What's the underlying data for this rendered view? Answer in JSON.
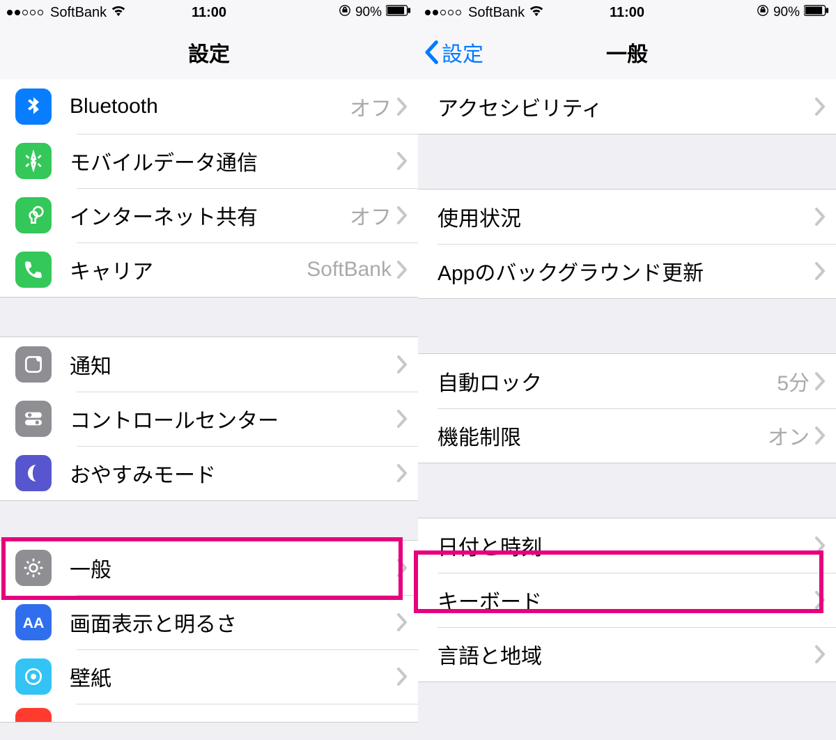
{
  "status": {
    "carrier": "SoftBank",
    "time": "11:00",
    "battery": "90%"
  },
  "left": {
    "title": "設定",
    "sections": [
      {
        "rows": [
          {
            "icon": "bluetooth",
            "color": "ic-blue",
            "label": "Bluetooth",
            "value": "オフ"
          },
          {
            "icon": "cellular",
            "color": "ic-green",
            "label": "モバイルデータ通信",
            "value": ""
          },
          {
            "icon": "hotspot",
            "color": "ic-green",
            "label": "インターネット共有",
            "value": "オフ"
          },
          {
            "icon": "phone",
            "color": "ic-green",
            "label": "キャリア",
            "value": "SoftBank"
          }
        ]
      },
      {
        "rows": [
          {
            "icon": "notify",
            "color": "ic-gray",
            "label": "通知",
            "value": ""
          },
          {
            "icon": "control",
            "color": "ic-gray2",
            "label": "コントロールセンター",
            "value": ""
          },
          {
            "icon": "dnd",
            "color": "ic-purple",
            "label": "おやすみモード",
            "value": ""
          }
        ]
      },
      {
        "rows": [
          {
            "icon": "general",
            "color": "ic-gray",
            "label": "一般",
            "value": ""
          },
          {
            "icon": "display",
            "color": "ic-indigo",
            "label": "画面表示と明るさ",
            "value": ""
          },
          {
            "icon": "wallpaper",
            "color": "ic-teal",
            "label": "壁紙",
            "value": ""
          },
          {
            "icon": "sound",
            "color": "ic-red",
            "label": "",
            "value": ""
          }
        ]
      }
    ]
  },
  "right": {
    "backLabel": "設定",
    "title": "一般",
    "sections": [
      {
        "rows": [
          {
            "label": "アクセシビリティ",
            "value": ""
          }
        ]
      },
      {
        "rows": [
          {
            "label": "使用状況",
            "value": ""
          },
          {
            "label": "Appのバックグラウンド更新",
            "value": ""
          }
        ]
      },
      {
        "rows": [
          {
            "label": "自動ロック",
            "value": "5分"
          },
          {
            "label": "機能制限",
            "value": "オン"
          }
        ]
      },
      {
        "rows": [
          {
            "label": "日付と時刻",
            "value": ""
          },
          {
            "label": "キーボード",
            "value": ""
          },
          {
            "label": "言語と地域",
            "value": ""
          }
        ]
      }
    ]
  }
}
